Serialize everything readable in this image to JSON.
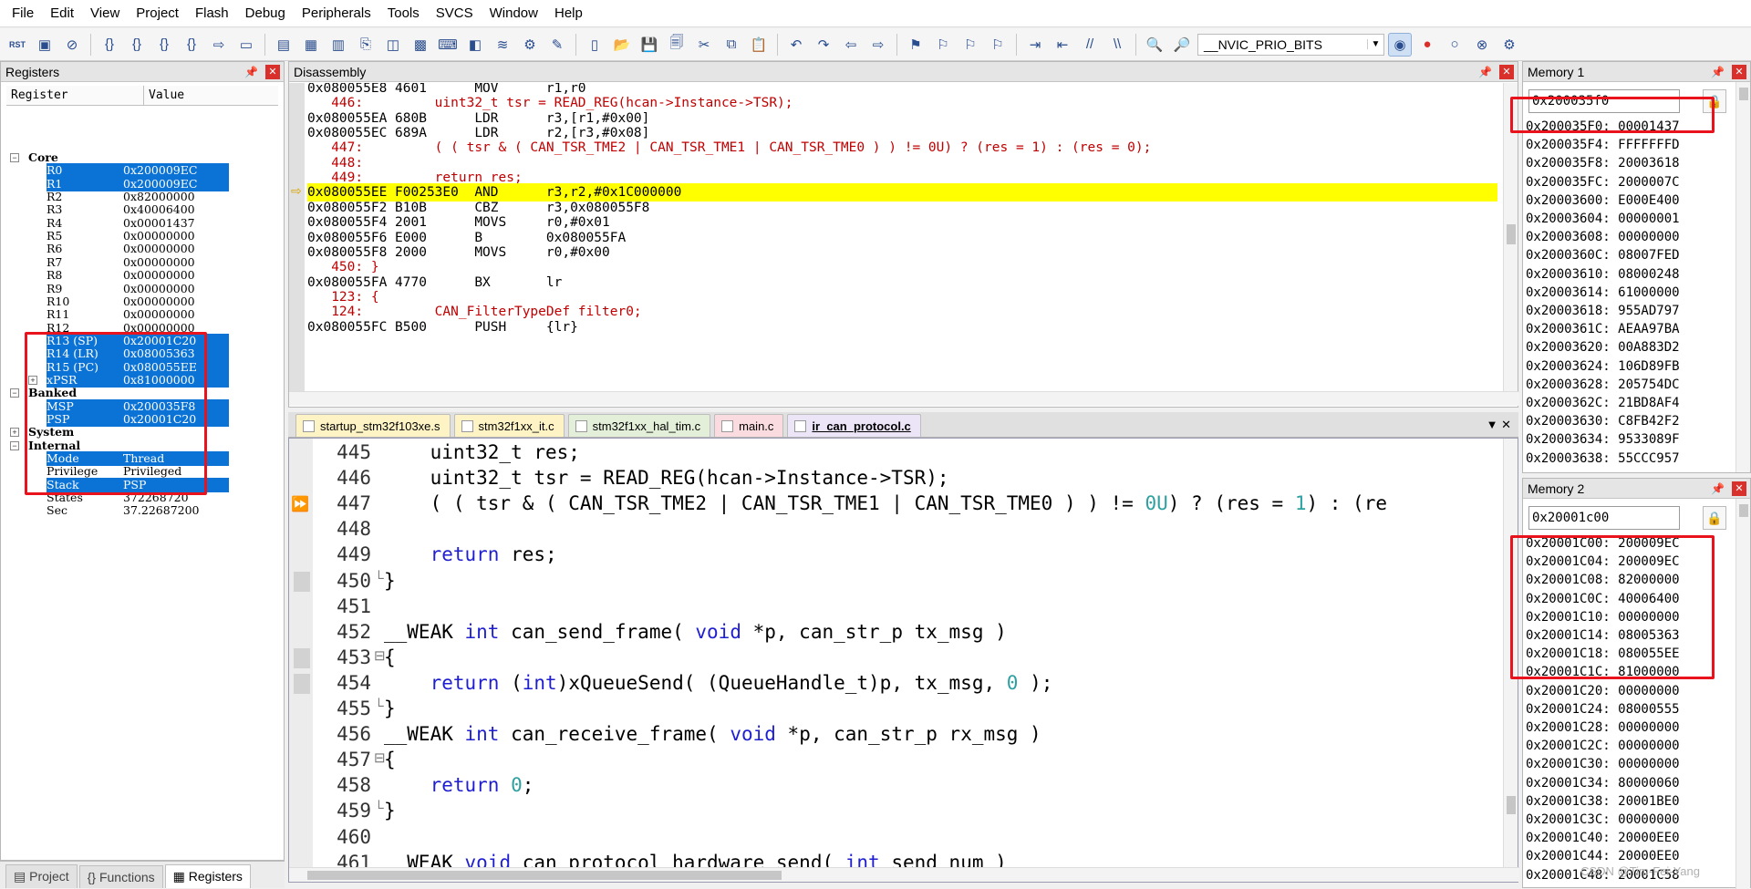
{
  "menu": [
    "File",
    "Edit",
    "View",
    "Project",
    "Flash",
    "Debug",
    "Peripherals",
    "Tools",
    "SVCS",
    "Window",
    "Help"
  ],
  "toolbar": {
    "combo_value": "__NVIC_PRIO_BITS",
    "rst_label": "RST",
    "icons": [
      "reset-icon",
      "run-icon",
      "stop-icon",
      "step-into-icon",
      "step-over-icon",
      "step-out-icon",
      "run-to-cursor-icon",
      "show-next-icon",
      "command-window-icon",
      "disassembly-icon",
      "symbols-icon",
      "registers-icon",
      "call-stack-icon",
      "watch-icon",
      "memory-icon",
      "serial-icon",
      "analysis-icon",
      "trace-icon",
      "system-viewer-icon",
      "toolbox-icon",
      "new-file-icon",
      "open-icon",
      "save-icon",
      "save-all-icon",
      "cut-icon",
      "copy-icon",
      "paste-icon",
      "undo-icon",
      "redo-icon",
      "nav-back-icon",
      "nav-forward-icon",
      "bookmark-icon",
      "bookmark-prev-icon",
      "bookmark-next-icon",
      "bookmark-clear-icon",
      "indent-icon",
      "unindent-icon",
      "comment-icon",
      "uncomment-icon",
      "find-in-files-icon",
      "find-icon",
      "debug-session-icon",
      "breakpoint-icon",
      "disable-breakpoint-icon",
      "kill-breakpoints-icon",
      "options-icon"
    ]
  },
  "registers": {
    "title": "Registers",
    "col_register": "Register",
    "col_value": "Value",
    "rows": [
      {
        "name": "Core",
        "value": "",
        "kind": "group",
        "toggle": "−"
      },
      {
        "name": "R0",
        "value": "0x200009EC",
        "kind": "sel"
      },
      {
        "name": "R1",
        "value": "0x200009EC",
        "kind": "sel"
      },
      {
        "name": "R2",
        "value": "0x82000000",
        "kind": "plain"
      },
      {
        "name": "R3",
        "value": "0x40006400",
        "kind": "plain"
      },
      {
        "name": "R4",
        "value": "0x00001437",
        "kind": "plain"
      },
      {
        "name": "R5",
        "value": "0x00000000",
        "kind": "plain"
      },
      {
        "name": "R6",
        "value": "0x00000000",
        "kind": "plain"
      },
      {
        "name": "R7",
        "value": "0x00000000",
        "kind": "plain"
      },
      {
        "name": "R8",
        "value": "0x00000000",
        "kind": "plain"
      },
      {
        "name": "R9",
        "value": "0x00000000",
        "kind": "plain"
      },
      {
        "name": "R10",
        "value": "0x00000000",
        "kind": "plain"
      },
      {
        "name": "R11",
        "value": "0x00000000",
        "kind": "plain"
      },
      {
        "name": "R12",
        "value": "0x00000000",
        "kind": "plain"
      },
      {
        "name": "R13 (SP)",
        "value": "0x20001C20",
        "kind": "sel"
      },
      {
        "name": "R14 (LR)",
        "value": "0x08005363",
        "kind": "sel"
      },
      {
        "name": "R15 (PC)",
        "value": "0x080055EE",
        "kind": "sel"
      },
      {
        "name": "xPSR",
        "value": "0x81000000",
        "kind": "sel",
        "toggle": "+"
      },
      {
        "name": "Banked",
        "value": "",
        "kind": "group",
        "toggle": "−"
      },
      {
        "name": "MSP",
        "value": "0x200035F8",
        "kind": "sel"
      },
      {
        "name": "PSP",
        "value": "0x20001C20",
        "kind": "sel"
      },
      {
        "name": "System",
        "value": "",
        "kind": "group",
        "toggle": "+"
      },
      {
        "name": "Internal",
        "value": "",
        "kind": "group",
        "toggle": "−"
      },
      {
        "name": "Mode",
        "value": "Thread",
        "kind": "sel"
      },
      {
        "name": "Privilege",
        "value": "Privileged",
        "kind": "plain"
      },
      {
        "name": "Stack",
        "value": "PSP",
        "kind": "sel"
      },
      {
        "name": "States",
        "value": "372268720",
        "kind": "plain"
      },
      {
        "name": "Sec",
        "value": "37.22687200",
        "kind": "plain"
      }
    ],
    "tabs": [
      {
        "label": "Project",
        "icon": "project-icon"
      },
      {
        "label": "Functions",
        "icon": "functions-icon"
      },
      {
        "label": "Registers",
        "icon": "registers-icon"
      }
    ]
  },
  "disassembly": {
    "title": "Disassembly",
    "lines": [
      {
        "text": "0x080055E8 4601      MOV      r1,r0",
        "kind": "asm"
      },
      {
        "text": "   446:         uint32_t tsr = READ_REG(hcan->Instance->TSR);",
        "kind": "src"
      },
      {
        "text": "0x080055EA 680B      LDR      r3,[r1,#0x00]",
        "kind": "asm"
      },
      {
        "text": "0x080055EC 689A      LDR      r2,[r3,#0x08]",
        "kind": "asm"
      },
      {
        "text": "   447:         ( ( tsr & ( CAN_TSR_TME2 | CAN_TSR_TME1 | CAN_TSR_TME0 ) ) != 0U) ? (res = 1) : (res = 0);",
        "kind": "src"
      },
      {
        "text": "   448:",
        "kind": "src"
      },
      {
        "text": "   449:         return res;",
        "kind": "src"
      },
      {
        "text": "0x080055EE F00253E0  AND      r3,r2,#0x1C000000",
        "kind": "cur"
      },
      {
        "text": "0x080055F2 B10B      CBZ      r3,0x080055F8",
        "kind": "asm"
      },
      {
        "text": "0x080055F4 2001      MOVS     r0,#0x01",
        "kind": "asm"
      },
      {
        "text": "0x080055F6 E000      B        0x080055FA",
        "kind": "asm"
      },
      {
        "text": "0x080055F8 2000      MOVS     r0,#0x00",
        "kind": "asm"
      },
      {
        "text": "   450: }",
        "kind": "src"
      },
      {
        "text": "0x080055FA 4770      BX       lr",
        "kind": "asm"
      },
      {
        "text": "   123: {",
        "kind": "src"
      },
      {
        "text": "   124:         CAN_FilterTypeDef filter0;",
        "kind": "src"
      },
      {
        "text": "0x080055FC B500      PUSH     {lr}",
        "kind": "asm"
      }
    ]
  },
  "file_tabs": [
    {
      "label": "startup_stm32f103xe.s",
      "color": "#fdf3c4"
    },
    {
      "label": "stm32f1xx_it.c",
      "color": "#fdf3c4"
    },
    {
      "label": "stm32f1xx_hal_tim.c",
      "color": "#e3efd9"
    },
    {
      "label": "main.c",
      "color": "#fadbe0"
    },
    {
      "label": "ir_can_protocol.c",
      "color": "#ece4f7"
    }
  ],
  "editor": {
    "lines": [
      {
        "n": "445",
        "fold": "",
        "segs": [
          [
            "    uint32_t res;",
            ""
          ]
        ]
      },
      {
        "n": "446",
        "fold": "",
        "segs": [
          [
            "    uint32_t tsr = READ_REG(hcan->Instance->TSR);",
            ""
          ]
        ]
      },
      {
        "n": "447",
        "fold": "",
        "segs": [
          [
            "    ( ( tsr & ( CAN_TSR_TME2 | CAN_TSR_TME1 | CAN_TSR_TME0 ) ) != ",
            ""
          ],
          [
            "0U",
            "num"
          ],
          [
            ") ? (res = ",
            ""
          ],
          [
            "1",
            "num"
          ],
          [
            ") : (re",
            ""
          ]
        ]
      },
      {
        "n": "448",
        "fold": "",
        "segs": [
          [
            "",
            ""
          ]
        ]
      },
      {
        "n": "449",
        "fold": "",
        "segs": [
          [
            "    ",
            ""
          ],
          [
            "return",
            "kw"
          ],
          [
            " res;",
            ""
          ]
        ]
      },
      {
        "n": "450",
        "fold": "end",
        "segs": [
          [
            "}",
            ""
          ]
        ]
      },
      {
        "n": "451",
        "fold": "",
        "segs": [
          [
            "",
            ""
          ]
        ]
      },
      {
        "n": "452",
        "fold": "",
        "segs": [
          [
            "__WEAK ",
            ""
          ],
          [
            "int",
            "kw"
          ],
          [
            " can_send_frame( ",
            ""
          ],
          [
            "void",
            "kw"
          ],
          [
            " *p, can_str_p tx_msg )",
            ""
          ]
        ]
      },
      {
        "n": "453",
        "fold": "start",
        "segs": [
          [
            "{",
            ""
          ]
        ]
      },
      {
        "n": "454",
        "fold": "",
        "segs": [
          [
            "    ",
            ""
          ],
          [
            "return",
            "kw"
          ],
          [
            " (",
            ""
          ],
          [
            "int",
            "kw"
          ],
          [
            ")xQueueSend( (QueueHandle_t)p, tx_msg, ",
            ""
          ],
          [
            "0",
            "num"
          ],
          [
            " );",
            ""
          ]
        ]
      },
      {
        "n": "455",
        "fold": "end",
        "segs": [
          [
            "}",
            ""
          ]
        ]
      },
      {
        "n": "456",
        "fold": "",
        "segs": [
          [
            "__WEAK ",
            ""
          ],
          [
            "int",
            "kw"
          ],
          [
            " can_receive_frame( ",
            ""
          ],
          [
            "void",
            "kw"
          ],
          [
            " *p, can_str_p rx_msg )",
            ""
          ]
        ]
      },
      {
        "n": "457",
        "fold": "start",
        "segs": [
          [
            "{",
            ""
          ]
        ]
      },
      {
        "n": "458",
        "fold": "",
        "segs": [
          [
            "    ",
            ""
          ],
          [
            "return",
            "kw"
          ],
          [
            " ",
            ""
          ],
          [
            "0",
            "num"
          ],
          [
            ";",
            ""
          ]
        ]
      },
      {
        "n": "459",
        "fold": "end",
        "segs": [
          [
            "}",
            ""
          ]
        ]
      },
      {
        "n": "460",
        "fold": "",
        "segs": [
          [
            "",
            ""
          ]
        ]
      },
      {
        "n": "461",
        "fold": "",
        "segs": [
          [
            "__WEAK ",
            ""
          ],
          [
            "void",
            "kw"
          ],
          [
            " can_protocol_hardware_send( ",
            ""
          ],
          [
            "int",
            "kw"
          ],
          [
            " send_num )",
            ""
          ]
        ]
      }
    ]
  },
  "memory1": {
    "title": "Memory 1",
    "address": "0x200035f0",
    "lines": [
      "0x200035F0: 00001437",
      "0x200035F4: FFFFFFFD",
      "0x200035F8: 20003618",
      "0x200035FC: 2000007C",
      "0x20003600: E000E400",
      "0x20003604: 00000001",
      "0x20003608: 00000000",
      "0x2000360C: 08007FED",
      "0x20003610: 08000248",
      "0x20003614: 61000000",
      "0x20003618: 955AD797",
      "0x2000361C: AEAA97BA",
      "0x20003620: 00A883D2",
      "0x20003624: 106D89FB",
      "0x20003628: 205754DC",
      "0x2000362C: 21BD8AF4",
      "0x20003630: C8FB42F2",
      "0x20003634: 9533089F",
      "0x20003638: 55CCC957"
    ]
  },
  "memory2": {
    "title": "Memory 2",
    "address": "0x20001c00",
    "lines": [
      "0x20001C00: 200009EC",
      "0x20001C04: 200009EC",
      "0x20001C08: 82000000",
      "0x20001C0C: 40006400",
      "0x20001C10: 00000000",
      "0x20001C14: 08005363",
      "0x20001C18: 080055EE",
      "0x20001C1C: 81000000",
      "0x20001C20: 00000000",
      "0x20001C24: 08000555",
      "0x20001C28: 00000000",
      "0x20001C2C: 00000000",
      "0x20001C30: 00000000",
      "0x20001C34: 80000060",
      "0x20001C38: 20001BE0",
      "0x20001C3C: 00000000",
      "0x20001C40: 20000EE0",
      "0x20001C44: 20000EE0",
      "0x20001C48: 20001C58"
    ]
  },
  "watermark": "CSDN @Tim-Fei-Yang",
  "colors": {
    "selection": "#0b73d6",
    "current_line": "#ffff00",
    "highlight_box": "#e8131c",
    "keyword": "#1f1fd0",
    "number": "#2fa0a0",
    "source_line": "#c00000"
  }
}
